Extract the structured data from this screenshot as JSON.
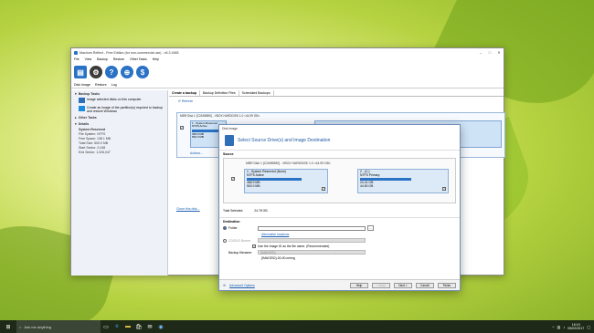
{
  "window": {
    "title": "Macrium Reflect - Free Edition (for non-commercial use) - v6.3.1665",
    "controls": [
      "–",
      "□",
      "✕"
    ],
    "menu": [
      "File",
      "View",
      "Backup",
      "Restore",
      "Other Tasks",
      "Help"
    ],
    "tabs": [
      "Disk Image",
      "Restore",
      "Log"
    ]
  },
  "left_pane": {
    "backup_tasks": "Backup Tasks",
    "task1": "Image selected disks on this computer",
    "task2": "Create an image of the partition(s) required to backup and restore Windows",
    "other_tasks": "Other Tasks",
    "details": "Details",
    "detail_title": "System Reserved",
    "detail_lines": [
      "File System: NTFS",
      "Free Space:  138.1 MB",
      "Total Size:   500.0 MB",
      "Start Sector: 2,048",
      "End Sector:  1,026,047"
    ]
  },
  "right_pane": {
    "tabs": [
      "Create a backup",
      "Backup Definition Files",
      "Scheduled Backups"
    ],
    "refresh": "Refresh",
    "disk_header": "MBR Disk 1 [C2A9B890] - VBOX HARDDISK 1.0  <44.99 GB>",
    "p1_name": "1 - System Reserved",
    "p1_fs": "NTFS Active",
    "p1_size1": "368.9 MB",
    "p1_size2": "500.0 MB",
    "actions": "Actions...",
    "clone": "Clone this disk..."
  },
  "dialog": {
    "title": "Disk Image",
    "heading": "Select Source Drive(s) and Image Destination",
    "source_label": "Source",
    "disk_header": "MBR Disk 1 [C2A9B890] - VBOX HARDDISK 1.0  <44.99 GB>",
    "p1": {
      "name": "1 - System Reserved (None)",
      "fs": "NTFS Active",
      "used": "368.9 MB",
      "total": "500.0 MB"
    },
    "p2": {
      "name": "2 - (C:)",
      "fs": "NTFS Primary",
      "used": "24.41 GB",
      "total": "44.50 GB"
    },
    "total_label": "Total Selected:",
    "total_value": "24.78 GB",
    "dest_label": "Destination",
    "folder": "Folder",
    "alt_locations": "Alternative locations",
    "cd_burner": "CD/DVD Burner",
    "use_id": "Use the Image ID as the file name. (Recommended)",
    "filename_label": "Backup filename:",
    "filename_value": "{IMAGEID}",
    "filename_note": "{IMAGEID}-00-00.mrimg",
    "advanced": "Advanced Options",
    "buttons": [
      "Help",
      "< Back",
      "Next >",
      "Cancel",
      "Finish"
    ]
  },
  "taskbar": {
    "search_placeholder": "Ask me anything",
    "time": "16:10",
    "date": "05/02/2017"
  }
}
